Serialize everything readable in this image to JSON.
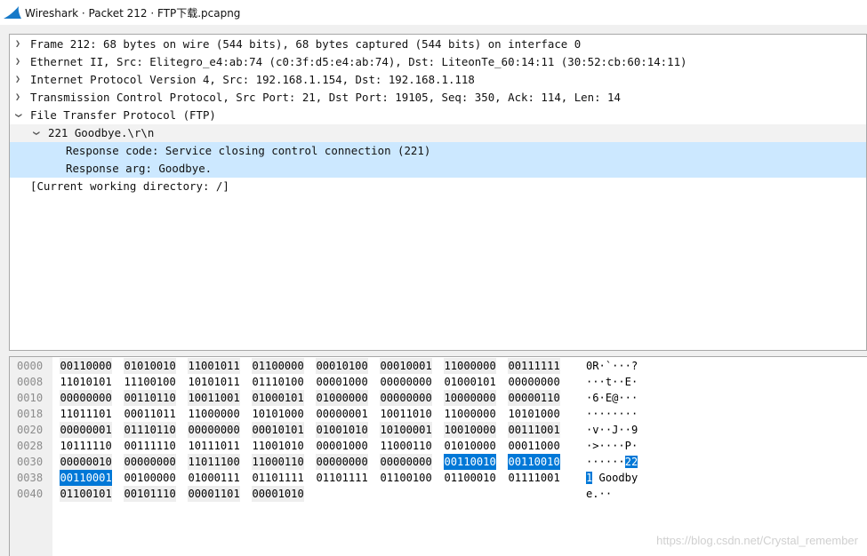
{
  "window": {
    "title": "Wireshark · Packet 212 · FTP下载.pcapng"
  },
  "colors": {
    "selection": "#cce8ff",
    "byte_highlight": "#0078d7",
    "brand": "#1679c8"
  },
  "tree": [
    {
      "text": "Frame 212: 68 bytes on wire (544 bits), 68 bytes captured (544 bits) on interface 0",
      "arrow": ">",
      "icon": "chevron-right-icon",
      "level": 0
    },
    {
      "text": "Ethernet II, Src: Elitegro_e4:ab:74 (c0:3f:d5:e4:ab:74), Dst: LiteonTe_60:14:11 (30:52:cb:60:14:11)",
      "arrow": ">",
      "icon": "chevron-right-icon",
      "level": 0
    },
    {
      "text": "Internet Protocol Version 4, Src: 192.168.1.154, Dst: 192.168.1.118",
      "arrow": ">",
      "icon": "chevron-right-icon",
      "level": 0
    },
    {
      "text": "Transmission Control Protocol, Src Port: 21, Dst Port: 19105, Seq: 350, Ack: 114, Len: 14",
      "arrow": ">",
      "icon": "chevron-right-icon",
      "level": 0
    },
    {
      "text": "File Transfer Protocol (FTP)",
      "arrow": "v",
      "icon": "chevron-down-icon",
      "level": 0
    },
    {
      "text": "221 Goodbye.\\r\\n",
      "arrow": "v",
      "icon": "chevron-down-icon",
      "level": 1
    },
    {
      "text": "Response code: Service closing control connection (221)",
      "arrow": "",
      "icon": "",
      "level": 2
    },
    {
      "text": "Response arg: Goodbye.",
      "arrow": "",
      "icon": "",
      "level": 2
    },
    {
      "text": "[Current working directory: /]",
      "arrow": "",
      "icon": "",
      "level": 0
    }
  ],
  "bytes": [
    {
      "offset": "0000",
      "bins": [
        "00110000",
        "01010010",
        "11001011",
        "01100000",
        "00010100",
        "00010001",
        "11000000",
        "00111111"
      ],
      "ascii": "0R·`···?"
    },
    {
      "offset": "0008",
      "bins": [
        "11010101",
        "11100100",
        "10101011",
        "01110100",
        "00001000",
        "00000000",
        "01000101",
        "00000000"
      ],
      "ascii": "···t··E·"
    },
    {
      "offset": "0010",
      "bins": [
        "00000000",
        "00110110",
        "10011001",
        "01000101",
        "01000000",
        "00000000",
        "10000000",
        "00000110"
      ],
      "ascii": "·6·E@···"
    },
    {
      "offset": "0018",
      "bins": [
        "11011101",
        "00011011",
        "11000000",
        "10101000",
        "00000001",
        "10011010",
        "11000000",
        "10101000"
      ],
      "ascii": "········"
    },
    {
      "offset": "0020",
      "bins": [
        "00000001",
        "01110110",
        "00000000",
        "00010101",
        "01001010",
        "10100001",
        "10010000",
        "00111001"
      ],
      "ascii": "·v··J··9"
    },
    {
      "offset": "0028",
      "bins": [
        "10111110",
        "00111110",
        "10111011",
        "11001010",
        "00001000",
        "11000110",
        "01010000",
        "00011000"
      ],
      "ascii": "·>····P·"
    },
    {
      "offset": "0030",
      "bins": [
        "00000010",
        "00000000",
        "11011100",
        "11000110",
        "00000000",
        "00000000",
        "00110010",
        "00110010"
      ],
      "ascii": "······22"
    },
    {
      "offset": "0038",
      "bins": [
        "00110001",
        "00100000",
        "01000111",
        "01101111",
        "01101111",
        "01100100",
        "01100010",
        "01111001"
      ],
      "ascii": "1 Goodby"
    },
    {
      "offset": "0040",
      "bins": [
        "01100101",
        "00101110",
        "00001101",
        "00001010"
      ],
      "ascii": "e.··"
    }
  ],
  "watermark": "https://blog.csdn.net/Crystal_remember"
}
